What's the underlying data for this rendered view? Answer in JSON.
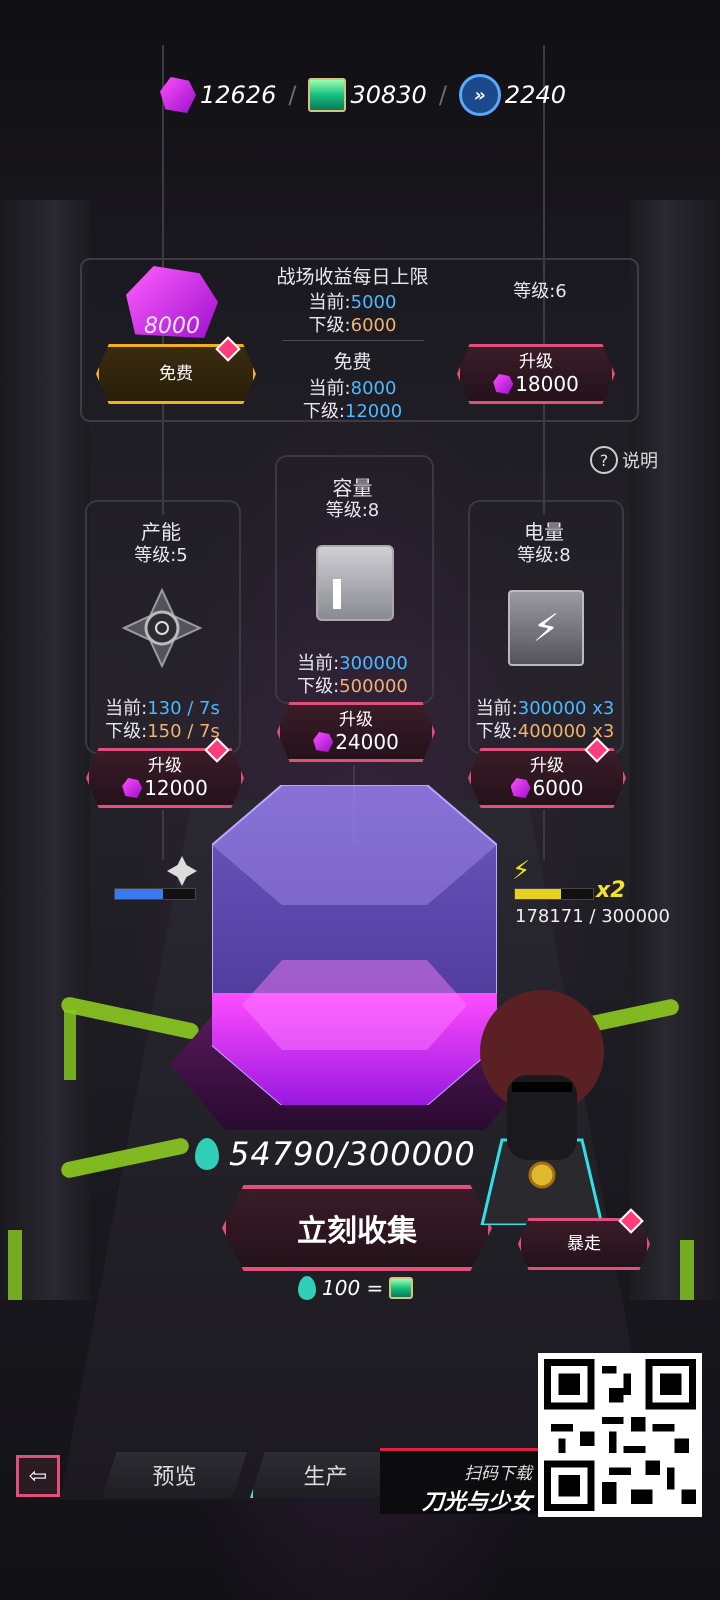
{
  "currencies": [
    {
      "icon": "gem-icon",
      "value": "12626"
    },
    {
      "icon": "scroll-icon",
      "value": "30830"
    },
    {
      "icon": "chevron-badge-icon",
      "value": "2240"
    }
  ],
  "reward_panel": {
    "gem_amount": "8000",
    "free_button": "免费",
    "title": "战场收益每日上限",
    "current_label": "当前:",
    "current_value": "5000",
    "next_label": "下级:",
    "next_value": "6000",
    "free_title": "免费",
    "free_current_label": "当前:",
    "free_current_value": "8000",
    "free_next_label": "下级:",
    "free_next_value": "12000",
    "level": "等级:6",
    "upgrade_label": "升级",
    "upgrade_cost": "18000"
  },
  "help_label": "说明",
  "capacity": {
    "title": "容量",
    "level": "等级:8",
    "current_label": "当前:",
    "current_value": "300000",
    "next_label": "下级:",
    "next_value": "500000",
    "upgrade_label": "升级",
    "upgrade_cost": "24000"
  },
  "production": {
    "title": "产能",
    "level": "等级:5",
    "current_label": "当前:",
    "current_value": "130 / 7s",
    "next_label": "下级:",
    "next_value": "150 / 7s",
    "upgrade_label": "升级",
    "upgrade_cost": "12000",
    "bar_fill": 0.6
  },
  "power": {
    "title": "电量",
    "level": "等级:8",
    "current_label": "当前:",
    "current_value": "300000 x3",
    "next_label": "下级:",
    "next_value": "400000 x3",
    "upgrade_label": "升级",
    "upgrade_cost": "6000",
    "multiplier": "x2",
    "progress_text": "178171 / 300000",
    "bar_fill": 0.594
  },
  "storage": {
    "amount": "54790/300000",
    "fill": 0.183,
    "collect_button": "立刻收集",
    "rate_text": "100 ="
  },
  "character": {
    "rampage_button": "暴走"
  },
  "nav": {
    "back": "⇦",
    "preview_tab": "预览",
    "produce_tab": "生产"
  },
  "promo": {
    "scan_text": "扫码下载",
    "game_name": "刀光与少女"
  },
  "colors": {
    "accent": "#e0507a",
    "gold": "#f0b020",
    "blue_value": "#4cb8ff",
    "orange_value": "#f0b070",
    "liquid": "#e040f0"
  }
}
